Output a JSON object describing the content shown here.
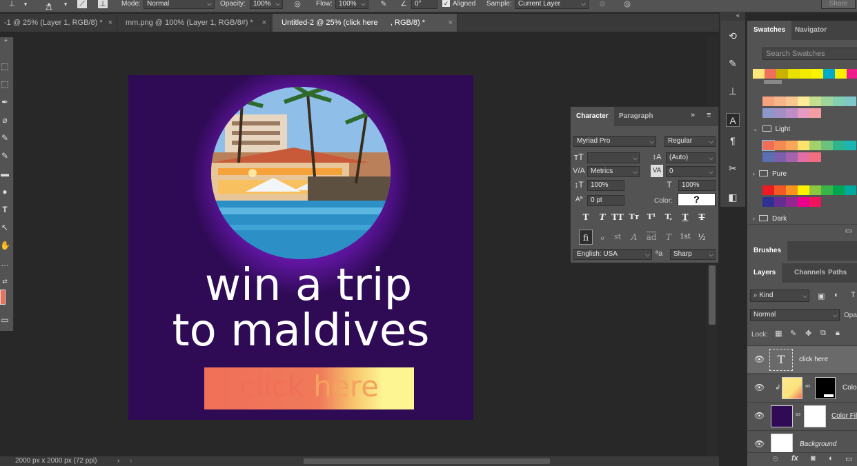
{
  "options_bar": {
    "brush_size": "21",
    "mode_label": "Mode:",
    "mode_value": "Normal",
    "opacity_label": "Opacity:",
    "opacity_value": "100%",
    "flow_label": "Flow:",
    "flow_value": "100%",
    "angle_value": "0°",
    "aligned_label": "Aligned",
    "sample_label": "Sample:",
    "sample_value": "Current Layer",
    "share_label": "Share"
  },
  "doc_tabs": [
    {
      "label": "-1 @ 25% (Layer 1, RGB/8) *",
      "active": false
    },
    {
      "label": "mm.png @ 100% (Layer 1, RGB/8#) *",
      "active": false
    },
    {
      "label": "Untitled-2 @ 25% (click here      , RGB/8) *",
      "active": true
    }
  ],
  "tab_close": "×",
  "artboard": {
    "headline_line1": "win a trip",
    "headline_line2": "to maldives",
    "cta_part1": "click ",
    "cta_part2": "here",
    "background_color": "#2f0a55",
    "cta_color": "#f06f58"
  },
  "status_bar": {
    "doc_info": "2000 px x 2000 px (72 ppi)",
    "arrow": "›",
    "left_arrow": "‹"
  },
  "character_panel": {
    "tabs": [
      "Character",
      "Paragraph"
    ],
    "font_family": "Myriad Pro",
    "font_style": "Regular",
    "font_size": "",
    "leading": "(Auto)",
    "kerning": "Metrics",
    "tracking": "0",
    "vertical_scale": "100%",
    "horizontal_scale": "100%",
    "baseline_shift": "0 pt",
    "color_label": "Color:",
    "color_value": "?",
    "format_buttons": [
      "T",
      "T",
      "TT",
      "Tт",
      "T¹",
      "T,",
      "T",
      "T"
    ],
    "opentype_buttons": [
      "ﬁ",
      "ℴ",
      "st",
      "A",
      "ad",
      "T",
      "1st",
      "½"
    ],
    "language": "English: USA",
    "aa_label": "ªa",
    "antialias": "Sharp"
  },
  "swatches_panel": {
    "tabs": [
      "Swatches",
      "Navigator"
    ],
    "search_placeholder": "Search Swatches",
    "recent_colors": [
      "#fde77a",
      "#f0715a",
      "#cab200",
      "#e8e000",
      "#f3ec00",
      "#faf400",
      "#00aacc",
      "#faf000",
      "#ee1c8c"
    ],
    "pastel_row1": [
      "#f5a37e",
      "#f7b58a",
      "#f9c890",
      "#fce999",
      "#c5df8e",
      "#9fd49b",
      "#83cfb1",
      "#7ec9c7"
    ],
    "pastel_row2": [
      "#8e97cb",
      "#a38fc4",
      "#c08ec6",
      "#e69ac3",
      "#f39ea1"
    ],
    "groups": [
      "Light",
      "Pure",
      "Dark"
    ],
    "light_row1": [
      "#f06e55",
      "#f58a53",
      "#f9a55b",
      "#fde369",
      "#a3d169",
      "#6cc27c",
      "#2bb58e",
      "#1db5b1"
    ],
    "light_row2": [
      "#5b6fb5",
      "#7b5fad",
      "#a463ab",
      "#e36ea4",
      "#f06e7e"
    ],
    "pure_row1": [
      "#ed1c24",
      "#f15a24",
      "#f7931e",
      "#fff200",
      "#8dc63f",
      "#39b54a",
      "#00a651",
      "#00a99d"
    ],
    "pure_row2": [
      "#2e3192",
      "#662d91",
      "#92278f",
      "#ec008c",
      "#ed145b"
    ]
  },
  "brushes_panel": {
    "tab": "Brushes"
  },
  "layers_panel": {
    "tabs": [
      "Layers",
      "Channels",
      "Paths"
    ],
    "filter_value": "Kind",
    "blend_value": "Normal",
    "opacity_label": "Opac",
    "lock_label": "Lock:",
    "layers": [
      {
        "name": "click here",
        "type": "text"
      },
      {
        "name": "Color",
        "type": "gradient-fill"
      },
      {
        "name": "Color Fill",
        "type": "color-fill"
      },
      {
        "name": "Background",
        "type": "background"
      }
    ],
    "text_thumb_glyph": "T",
    "link_glyph": "∞",
    "fx_label": "fx"
  }
}
